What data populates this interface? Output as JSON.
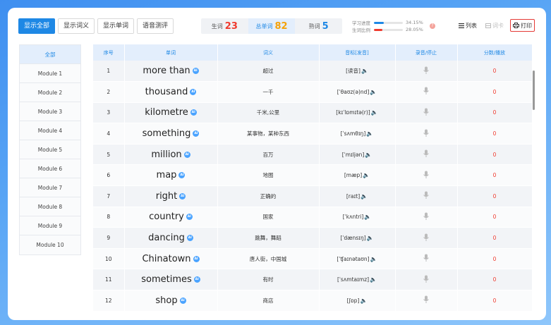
{
  "toolbar": {
    "show_all": "显示全部",
    "show_meaning": "显示词义",
    "show_word": "显示单词",
    "voice_eval": "语音测评"
  },
  "stats": {
    "new_label": "生词",
    "new_value": "23",
    "total_label": "总单词",
    "total_value": "82",
    "familiar_label": "熟词",
    "familiar_value": "5"
  },
  "progress": {
    "study_label": "学习进度",
    "study_value": "34.15%",
    "study_fraction": 0.3415,
    "study_color": "#1e88e5",
    "new_ratio_label": "生词比例",
    "new_ratio_value": "28.05%",
    "new_ratio_fraction": 0.2805,
    "new_ratio_color": "#f03a2e"
  },
  "right_tools": {
    "list_label": "列表",
    "card_label": "词卡",
    "print_label": "打印"
  },
  "sidebar": {
    "items": [
      {
        "label": "全部"
      },
      {
        "label": "Module 1"
      },
      {
        "label": "Module 2"
      },
      {
        "label": "Module 3"
      },
      {
        "label": "Module 4"
      },
      {
        "label": "Module 5"
      },
      {
        "label": "Module 6"
      },
      {
        "label": "Module 7"
      },
      {
        "label": "Module 8"
      },
      {
        "label": "Module 9"
      },
      {
        "label": "Module 10"
      }
    ]
  },
  "table": {
    "headers": {
      "index": "序号",
      "word": "单词",
      "meaning": "词义",
      "phonetic": "音标[发音]",
      "record": "录音/停止",
      "score": "分数/播放"
    },
    "rows": [
      {
        "index": "1",
        "word": "more than",
        "meaning": "超过",
        "phonetic": "[读音]",
        "score": "0"
      },
      {
        "index": "2",
        "word": "thousand",
        "meaning": "一千",
        "phonetic": "[ˈθaʊz(ə)nd]",
        "score": "0"
      },
      {
        "index": "3",
        "word": "kilometre",
        "meaning": "千米,公里",
        "phonetic": "[kɪˈlɒmɪtə(r)]",
        "score": "0"
      },
      {
        "index": "4",
        "word": "something",
        "meaning": "某事物，某种东西",
        "phonetic": "[ˈsʌmθɪŋ]",
        "score": "0"
      },
      {
        "index": "5",
        "word": "million",
        "meaning": "百万",
        "phonetic": "[ˈmɪljən]",
        "score": "0"
      },
      {
        "index": "6",
        "word": "map",
        "meaning": "地图",
        "phonetic": "[mæp]",
        "score": "0"
      },
      {
        "index": "7",
        "word": "right",
        "meaning": "正确的",
        "phonetic": "[raɪt]",
        "score": "0"
      },
      {
        "index": "8",
        "word": "country",
        "meaning": "国家",
        "phonetic": "[ˈkʌntri]",
        "score": "0"
      },
      {
        "index": "9",
        "word": "dancing",
        "meaning": "跳舞，舞蹈",
        "phonetic": "[ˈdænsɪŋ]",
        "score": "0"
      },
      {
        "index": "10",
        "word": "Chinatown",
        "meaning": "唐人街，中国城",
        "phonetic": "[ˈʧaɪnətaʊn]",
        "score": "0"
      },
      {
        "index": "11",
        "word": "sometimes",
        "meaning": "有时",
        "phonetic": "[ˈsʌmtaɪmz]",
        "score": "0"
      },
      {
        "index": "12",
        "word": "shop",
        "meaning": "商店",
        "phonetic": "[ʃɒp]",
        "score": "0"
      }
    ]
  },
  "badge_text": "AI",
  "question_mark": "?",
  "colors": {
    "accent": "#1e88e5",
    "score": "#f03a2e"
  }
}
